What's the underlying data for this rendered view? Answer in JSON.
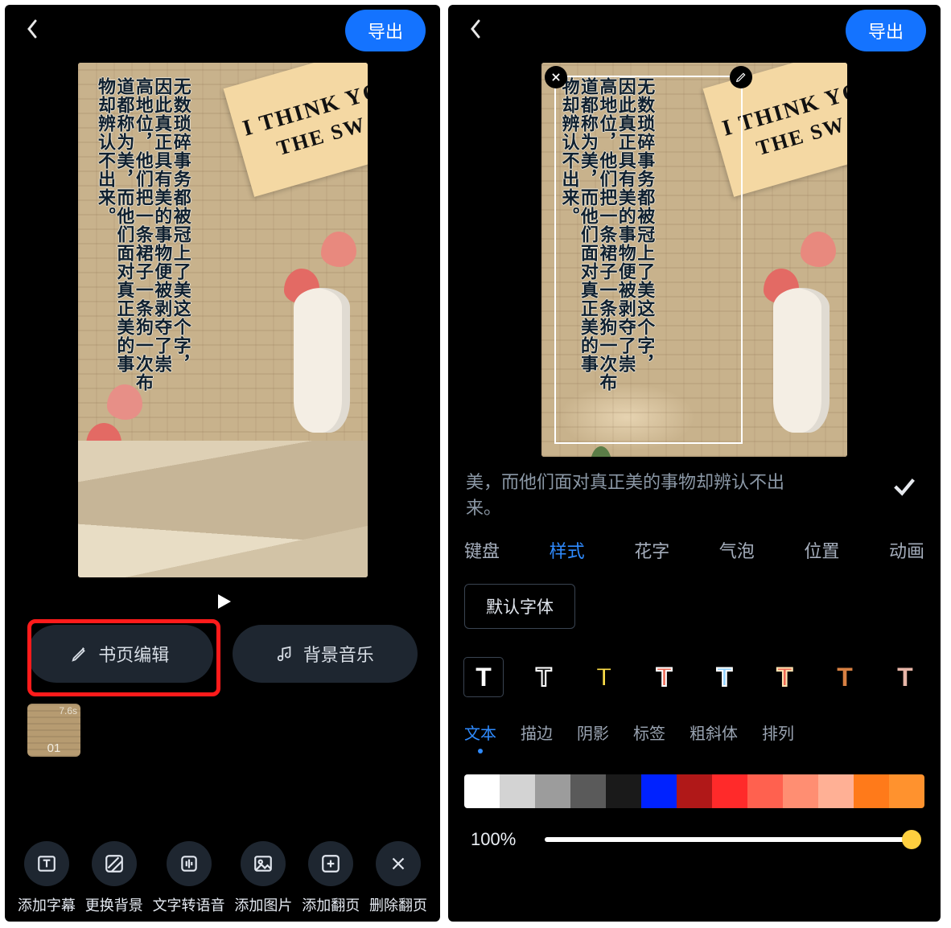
{
  "colors": {
    "accent": "#1473ff",
    "highlight": "#ff1b1b"
  },
  "export_label": "导出",
  "canvas_text": {
    "columns": [
      "无数琐碎事务都被冠上了美这个字，",
      "因此真正具有美的事物便被剥夺了崇",
      "高地位，他们把一条裙子一条狗一次布",
      "道都称为美，而他们面对真正美的事",
      "物却辨认不出来。"
    ],
    "sticky": {
      "line1": "I THINK YO",
      "line2": "THE SW"
    }
  },
  "left": {
    "play_icon": "play",
    "mid_buttons": {
      "edit": {
        "icon": "pencil",
        "label": "书页编辑"
      },
      "music": {
        "icon": "music-note",
        "label": "背景音乐"
      }
    },
    "thumb": {
      "duration": "7.6s",
      "index": "01"
    },
    "tools": [
      {
        "id": "add-subtitle",
        "label": "添加字幕",
        "icon": "text-box"
      },
      {
        "id": "change-bg",
        "label": "更换背景",
        "icon": "diag-lines"
      },
      {
        "id": "tts",
        "label": "文字转语音",
        "icon": "voice-bars"
      },
      {
        "id": "add-image",
        "label": "添加图片",
        "icon": "image"
      },
      {
        "id": "add-page",
        "label": "添加翻页",
        "icon": "plus-box"
      },
      {
        "id": "delete-page",
        "label": "删除翻页",
        "icon": "x"
      }
    ]
  },
  "right": {
    "text_preview": {
      "line1": "美，而他们面对真正美的事物却辨认不出",
      "line2": "来。"
    },
    "tabs": [
      {
        "id": "keyboard",
        "label": "键盘"
      },
      {
        "id": "style",
        "label": "样式",
        "active": true
      },
      {
        "id": "art",
        "label": "花字"
      },
      {
        "id": "bubble",
        "label": "气泡"
      },
      {
        "id": "position",
        "label": "位置"
      },
      {
        "id": "anim",
        "label": "动画"
      }
    ],
    "font_default": "默认字体",
    "preset_glyph": "T",
    "subtabs": [
      {
        "id": "text",
        "label": "文本",
        "active": true
      },
      {
        "id": "stroke",
        "label": "描边"
      },
      {
        "id": "shadow",
        "label": "阴影"
      },
      {
        "id": "tag",
        "label": "标签"
      },
      {
        "id": "bolditalic",
        "label": "粗斜体"
      },
      {
        "id": "arrange",
        "label": "排列"
      }
    ],
    "swatches": [
      "#ffffff",
      "#d3d3d3",
      "#9c9c9c",
      "#5a5a5a",
      "#1a1a1a",
      "#0022ff",
      "#b01818",
      "#ff2a2a",
      "#ff614f",
      "#ff8e72",
      "#ffb095",
      "#ff7a1a",
      "#ff922e"
    ],
    "opacity": {
      "percent_label": "100%",
      "value": 100
    }
  }
}
